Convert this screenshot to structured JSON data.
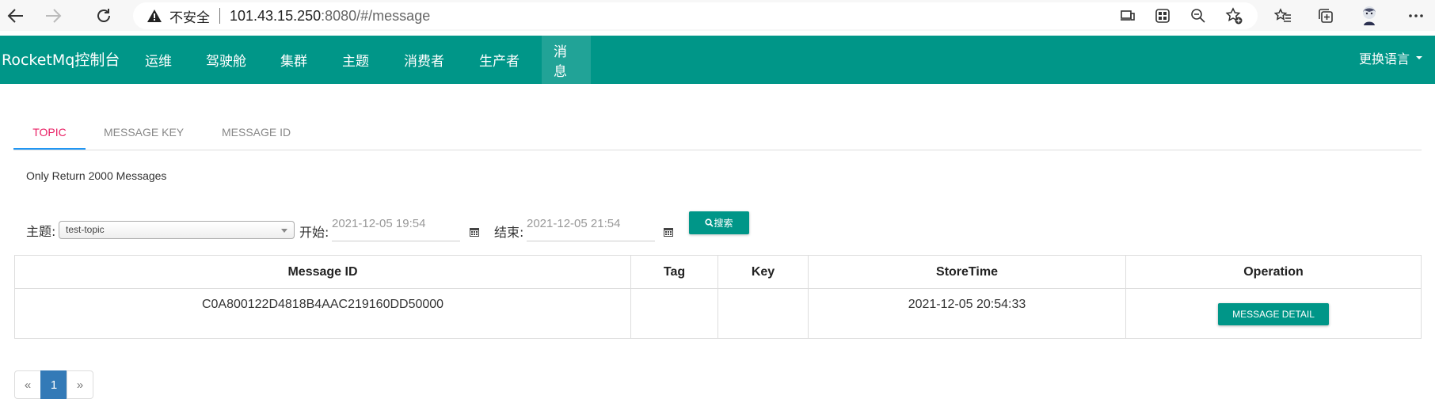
{
  "browser": {
    "insecure_label": "不安全",
    "url_host": "101.43.15.250",
    "url_rest": ":8080/#/message"
  },
  "navbar": {
    "brand": "RocketMq控制台",
    "items": [
      "运维",
      "驾驶舱",
      "集群",
      "主题",
      "消费者",
      "生产者",
      "消息"
    ],
    "active_index": 6,
    "language": "更换语言"
  },
  "tabs": [
    "TOPIC",
    "MESSAGE KEY",
    "MESSAGE ID"
  ],
  "notice": "Only Return 2000 Messages",
  "search": {
    "topic_label": "主题:",
    "topic_value": "test-topic",
    "start_label": "开始:",
    "start_value": "2021-12-05 19:54",
    "end_label": "结束:",
    "end_value": "2021-12-05 21:54",
    "search_button": "搜索"
  },
  "table": {
    "headers": [
      "Message ID",
      "Tag",
      "Key",
      "StoreTime",
      "Operation"
    ],
    "rows": [
      {
        "message_id": "C0A800122D4818B4AAC219160DD50000",
        "tag": "",
        "key": "",
        "store_time": "2021-12-05 20:54:33",
        "operation": "MESSAGE DETAIL"
      }
    ]
  },
  "pagination": {
    "prev": "«",
    "current": "1",
    "next": "»"
  },
  "colors": {
    "primary": "#009688",
    "tab_active_text": "#e91e63",
    "tab_active_underline": "#2196f3",
    "page_active": "#337ab7"
  }
}
